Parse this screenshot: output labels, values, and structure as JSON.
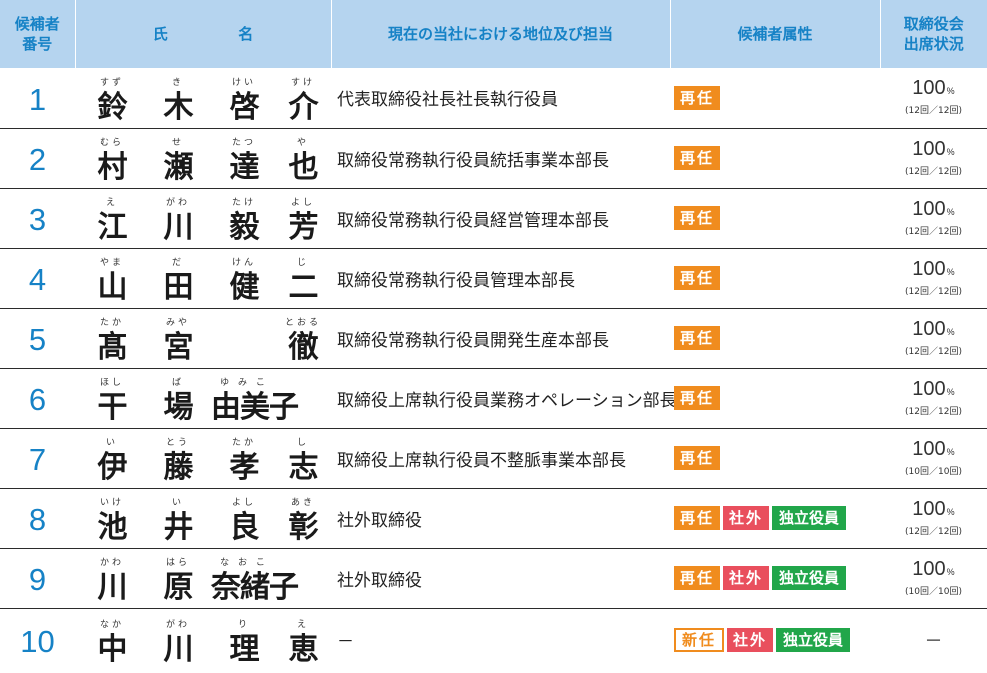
{
  "header": {
    "num": "候補者\n番号",
    "name_a": "氏",
    "name_b": "名",
    "position": "現在の当社における地位及び担当",
    "attributes": "候補者属性",
    "attendance": "取締役会\n出席状況"
  },
  "colors": {
    "header_bg": "#b5d4ef",
    "header_text": "#1682c6",
    "reappoint_badge": "#f08c1e",
    "outside_badge": "#e94f5d",
    "independent_badge": "#21a64a"
  },
  "candidates": [
    {
      "num": "1",
      "names": [
        {
          "ruby": "すず",
          "kanji": "鈴"
        },
        {
          "ruby": "き",
          "kanji": "木"
        },
        {
          "ruby": "けい",
          "kanji": "啓"
        },
        {
          "ruby": "すけ",
          "kanji": "介"
        }
      ],
      "position": "代表取締役社長社長執行役員",
      "badges": [
        "再任"
      ],
      "attendance_pct": "100",
      "attendance_unit": "%",
      "attendance_detail": "(12回／12回)"
    },
    {
      "num": "2",
      "names": [
        {
          "ruby": "むら",
          "kanji": "村"
        },
        {
          "ruby": "せ",
          "kanji": "瀬"
        },
        {
          "ruby": "たつ",
          "kanji": "達"
        },
        {
          "ruby": "や",
          "kanji": "也"
        }
      ],
      "position": "取締役常務執行役員統括事業本部長",
      "badges": [
        "再任"
      ],
      "attendance_pct": "100",
      "attendance_unit": "%",
      "attendance_detail": "(12回／12回)"
    },
    {
      "num": "3",
      "names": [
        {
          "ruby": "え",
          "kanji": "江"
        },
        {
          "ruby": "がわ",
          "kanji": "川"
        },
        {
          "ruby": "たけ",
          "kanji": "毅"
        },
        {
          "ruby": "よし",
          "kanji": "芳"
        }
      ],
      "position": "取締役常務執行役員経営管理本部長",
      "badges": [
        "再任"
      ],
      "attendance_pct": "100",
      "attendance_unit": "%",
      "attendance_detail": "(12回／12回)"
    },
    {
      "num": "4",
      "names": [
        {
          "ruby": "やま",
          "kanji": "山"
        },
        {
          "ruby": "だ",
          "kanji": "田"
        },
        {
          "ruby": "けん",
          "kanji": "健"
        },
        {
          "ruby": "じ",
          "kanji": "二"
        }
      ],
      "position": "取締役常務執行役員管理本部長",
      "badges": [
        "再任"
      ],
      "attendance_pct": "100",
      "attendance_unit": "%",
      "attendance_detail": "(12回／12回)"
    },
    {
      "num": "5",
      "names": [
        {
          "ruby": "たか",
          "kanji": "髙"
        },
        {
          "ruby": "みや",
          "kanji": "宮"
        },
        {
          "ruby": "",
          "kanji": ""
        },
        {
          "ruby": "とおる",
          "kanji": "徹"
        }
      ],
      "position": "取締役常務執行役員開発生産本部長",
      "badges": [
        "再任"
      ],
      "attendance_pct": "100",
      "attendance_unit": "%",
      "attendance_detail": "(12回／12回)"
    },
    {
      "num": "6",
      "names": [
        {
          "ruby": "ほし",
          "kanji": "干"
        },
        {
          "ruby": "ば",
          "kanji": "場"
        },
        {
          "ruby": "ゆ み こ",
          "kanji": "由美子"
        },
        {
          "ruby": "",
          "kanji": ""
        }
      ],
      "position": "取締役上席執行役員業務オペレーション部長",
      "badges": [
        "再任"
      ],
      "attendance_pct": "100",
      "attendance_unit": "%",
      "attendance_detail": "(12回／12回)"
    },
    {
      "num": "7",
      "names": [
        {
          "ruby": "い",
          "kanji": "伊"
        },
        {
          "ruby": "とう",
          "kanji": "藤"
        },
        {
          "ruby": "たか",
          "kanji": "孝"
        },
        {
          "ruby": "し",
          "kanji": "志"
        }
      ],
      "position": "取締役上席執行役員不整脈事業本部長",
      "badges": [
        "再任"
      ],
      "attendance_pct": "100",
      "attendance_unit": "%",
      "attendance_detail": "(10回／10回)"
    },
    {
      "num": "8",
      "names": [
        {
          "ruby": "いけ",
          "kanji": "池"
        },
        {
          "ruby": "い",
          "kanji": "井"
        },
        {
          "ruby": "よし",
          "kanji": "良"
        },
        {
          "ruby": "あき",
          "kanji": "彰"
        }
      ],
      "position": "社外取締役",
      "badges": [
        "再任",
        "社外",
        "独立役員"
      ],
      "attendance_pct": "100",
      "attendance_unit": "%",
      "attendance_detail": "(12回／12回)"
    },
    {
      "num": "9",
      "names": [
        {
          "ruby": "かわ",
          "kanji": "川"
        },
        {
          "ruby": "はら",
          "kanji": "原"
        },
        {
          "ruby": "な お こ",
          "kanji": "奈緒子"
        },
        {
          "ruby": "",
          "kanji": ""
        }
      ],
      "position": "社外取締役",
      "badges": [
        "再任",
        "社外",
        "独立役員"
      ],
      "attendance_pct": "100",
      "attendance_unit": "%",
      "attendance_detail": "(10回／10回)"
    },
    {
      "num": "10",
      "names": [
        {
          "ruby": "なか",
          "kanji": "中"
        },
        {
          "ruby": "がわ",
          "kanji": "川"
        },
        {
          "ruby": "り",
          "kanji": "理"
        },
        {
          "ruby": "え",
          "kanji": "恵"
        }
      ],
      "position": "－",
      "badges": [
        "新任",
        "社外",
        "独立役員"
      ],
      "attendance_pct": "",
      "attendance_unit": "",
      "attendance_detail": "",
      "attendance_dash": "－"
    }
  ]
}
